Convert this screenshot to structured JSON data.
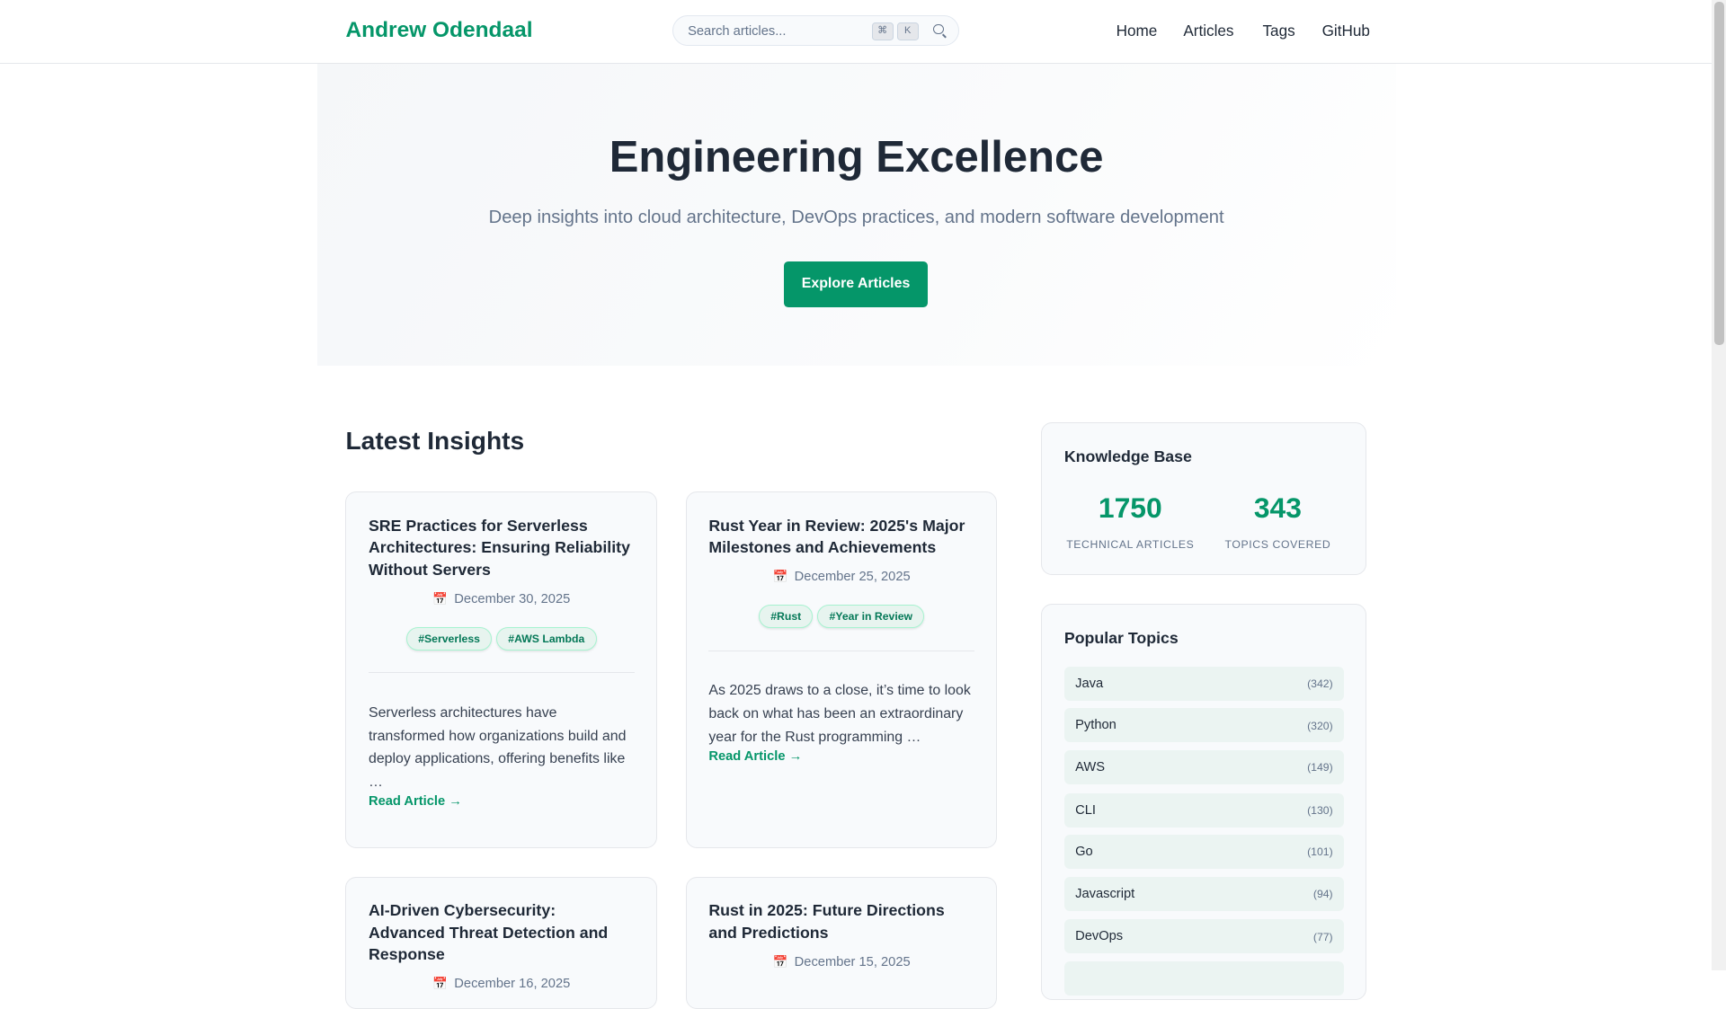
{
  "header": {
    "logo": "Andrew Odendaal",
    "search_placeholder": "Search articles...",
    "kbd": [
      "⌘",
      "K"
    ],
    "nav": [
      "Home",
      "Articles",
      "Tags",
      "GitHub"
    ]
  },
  "hero": {
    "title": "Engineering Excellence",
    "subtitle": "Deep insights into cloud architecture, DevOps practices, and modern software development",
    "cta": "Explore Articles"
  },
  "latest": {
    "title": "Latest Insights",
    "read_more": "Read Article →",
    "cards": [
      {
        "title": "SRE Practices for Serverless Architectures: Ensuring Reliability Without Servers",
        "date": "December 30, 2025",
        "tags": [
          "#Serverless",
          "#AWS Lambda"
        ],
        "excerpt": "Serverless architectures have transformed how organizations build and deploy applications, offering benefits like …"
      },
      {
        "title": "Rust Year in Review: 2025's Major Milestones and Achievements",
        "date": "December 25, 2025",
        "tags": [
          "#Rust",
          "#Year in Review"
        ],
        "excerpt": "As 2025 draws to a close, it’s time to look back on what has been an extraordinary year for the Rust programming …"
      },
      {
        "title": "AI-Driven Cybersecurity: Advanced Threat Detection and Response",
        "date": "December 16, 2025"
      },
      {
        "title": "Rust in 2025: Future Directions and Predictions",
        "date": "December 15, 2025"
      }
    ]
  },
  "knowledge": {
    "title": "Knowledge Base",
    "articles": "1750",
    "articles_label": "TECHNICAL ARTICLES",
    "topics": "343",
    "topics_label": "TOPICS COVERED"
  },
  "popular": {
    "title": "Popular Topics",
    "items": [
      {
        "name": "Java",
        "count": "(342)"
      },
      {
        "name": "Python",
        "count": "(320)"
      },
      {
        "name": "AWS",
        "count": "(149)"
      },
      {
        "name": "CLI",
        "count": "(130)"
      },
      {
        "name": "Go",
        "count": "(101)"
      },
      {
        "name": "Javascript",
        "count": "(94)"
      },
      {
        "name": "DevOps",
        "count": "(77)"
      }
    ]
  },
  "colors": {
    "accent": "#059669"
  }
}
